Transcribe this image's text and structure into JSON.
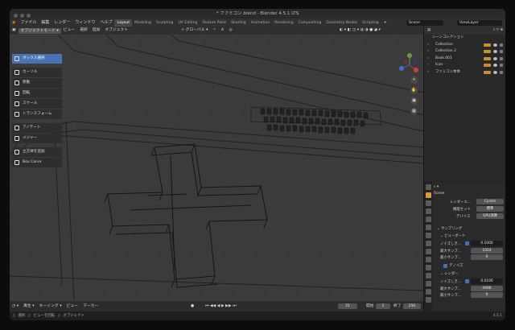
{
  "window": {
    "title": "* ファミコン.blend - Blender 4.5.1 LTS"
  },
  "menu": [
    "ファイル",
    "編集",
    "レンダー",
    "ウィンドウ",
    "ヘルプ"
  ],
  "workspaces": [
    {
      "label": "Layout",
      "active": true
    },
    {
      "label": "Modeling",
      "active": false
    },
    {
      "label": "Sculpting",
      "active": false
    },
    {
      "label": "UV Editing",
      "active": false
    },
    {
      "label": "Texture Paint",
      "active": false
    },
    {
      "label": "Shading",
      "active": false
    },
    {
      "label": "Animation",
      "active": false
    },
    {
      "label": "Rendering",
      "active": false
    },
    {
      "label": "Compositing",
      "active": false
    },
    {
      "label": "Geometry Nodes",
      "active": false
    },
    {
      "label": "Scripting",
      "active": false
    }
  ],
  "topbar_right": {
    "scene": "Scene",
    "view_layer": "ViewLayer"
  },
  "viewport_header": {
    "mode": "オブジェクトモード",
    "menus": [
      "ビュー",
      "選択",
      "追加",
      "オブジェクト"
    ],
    "orientation": "グローバル",
    "options": "オプション"
  },
  "toolbar": [
    {
      "label": "ボックス選択",
      "active": true
    },
    {
      "label": "カーソル",
      "active": false
    },
    {
      "label": "移動",
      "active": false
    },
    {
      "label": "回転",
      "active": false
    },
    {
      "label": "スケール",
      "active": false
    },
    {
      "label": "トランスフォーム",
      "active": false
    },
    {
      "label": "アノテート",
      "active": false
    },
    {
      "label": "メジャー",
      "active": false
    },
    {
      "label": "立方体を追加",
      "active": false
    },
    {
      "label": "Box Carve",
      "active": false
    }
  ],
  "outliner": {
    "header": "シーンコレクション",
    "items": [
      "Collection",
      "Collection 2",
      "Book.003",
      "Icon",
      "ファミコン本体"
    ]
  },
  "properties": {
    "scene": "Scene",
    "render_engine_label": "レンダーエ...",
    "render_engine": "Cycles",
    "feature_set_label": "機能セット",
    "feature_set": "標準",
    "device_label": "デバイス",
    "device": "GPU演算",
    "sampling": "サンプリング",
    "viewport": "ビューポート",
    "noise_label": "ノイズしき...",
    "noise_value": "0.1000",
    "max_samples_label": "最大サンプ...",
    "max_samples": "1024",
    "min_samples_label": "最小サンプ...",
    "min_samples": "0",
    "denoise": "デノイズ",
    "render": "レンダー",
    "render_noise_value": "0.0100",
    "render_max_samples": "4096",
    "render_min_samples": "0"
  },
  "timeline": {
    "buttons": [
      "再生",
      "キーイング",
      "ビュー",
      "マーカー"
    ],
    "current_frame": "21",
    "start_label": "開始",
    "start": "1",
    "end_label": "終了",
    "end": "250"
  },
  "statusbar": {
    "items": [
      "選択",
      "ビューを回転",
      "オブジェクト"
    ],
    "version": "4.5.1"
  }
}
